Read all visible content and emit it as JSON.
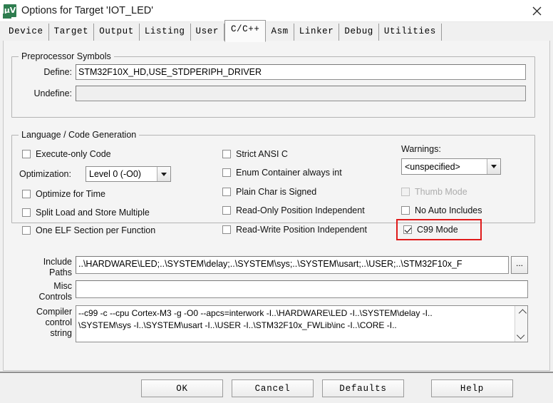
{
  "window": {
    "title": "Options for Target 'IOT_LED'",
    "icon": "keil-uvision-icon",
    "close_label": "✕"
  },
  "tabs": [
    {
      "label": "Device",
      "active": false
    },
    {
      "label": "Target",
      "active": false
    },
    {
      "label": "Output",
      "active": false
    },
    {
      "label": "Listing",
      "active": false
    },
    {
      "label": "User",
      "active": false
    },
    {
      "label": "C/C++",
      "active": true
    },
    {
      "label": "Asm",
      "active": false
    },
    {
      "label": "Linker",
      "active": false
    },
    {
      "label": "Debug",
      "active": false
    },
    {
      "label": "Utilities",
      "active": false
    }
  ],
  "preprocessor": {
    "legend": "Preprocessor Symbols",
    "define_label": "Define:",
    "define_value": "STM32F10X_HD,USE_STDPERIPH_DRIVER",
    "undefine_label": "Undefine:",
    "undefine_value": ""
  },
  "language": {
    "legend": "Language / Code Generation",
    "col_left": [
      {
        "label": "Execute-only Code",
        "checked": false,
        "disabled": false
      },
      {
        "label": "Optimize for Time",
        "checked": false,
        "disabled": false
      },
      {
        "label": "Split Load and Store Multiple",
        "checked": false,
        "disabled": false
      },
      {
        "label": "One ELF Section per Function",
        "checked": false,
        "disabled": false
      }
    ],
    "optimization_label": "Optimization:",
    "optimization_value": "Level 0 (-O0)",
    "col_mid": [
      {
        "label": "Strict ANSI C",
        "checked": false,
        "disabled": false
      },
      {
        "label": "Enum Container always int",
        "checked": false,
        "disabled": false
      },
      {
        "label": "Plain Char is Signed",
        "checked": false,
        "disabled": false
      },
      {
        "label": "Read-Only Position Independent",
        "checked": false,
        "disabled": false
      },
      {
        "label": "Read-Write Position Independent",
        "checked": false,
        "disabled": false
      }
    ],
    "warnings_label": "Warnings:",
    "warnings_value": "<unspecified>",
    "col_right": [
      {
        "label": "Thumb Mode",
        "checked": false,
        "disabled": true
      },
      {
        "label": "No Auto Includes",
        "checked": false,
        "disabled": false
      },
      {
        "label": "C99 Mode",
        "checked": true,
        "disabled": false,
        "highlight": true
      }
    ],
    "highlight_color": "#e01b1b"
  },
  "paths": {
    "include_label": "Include\nPaths",
    "include_label_line1": "Include",
    "include_label_line2": "Paths",
    "include_value": "..\\HARDWARE\\LED;..\\SYSTEM\\delay;..\\SYSTEM\\sys;..\\SYSTEM\\usart;..\\USER;..\\STM32F10x_F",
    "browse_label": "...",
    "misc_label_line1": "Misc",
    "misc_label_line2": "Controls",
    "misc_value": "",
    "compiler_label_line1": "Compiler",
    "compiler_label_line2": "control",
    "compiler_label_line3": "string",
    "compiler_line1": "--c99 -c --cpu Cortex-M3 -g -O0 --apcs=interwork -I..\\HARDWARE\\LED -I..\\SYSTEM\\delay -I..",
    "compiler_line2": "\\SYSTEM\\sys -I..\\SYSTEM\\usart -I..\\USER -I..\\STM32F10x_FWLib\\inc -I..\\CORE -I.."
  },
  "buttons": {
    "ok": "OK",
    "cancel": "Cancel",
    "defaults": "Defaults",
    "help": "Help"
  }
}
